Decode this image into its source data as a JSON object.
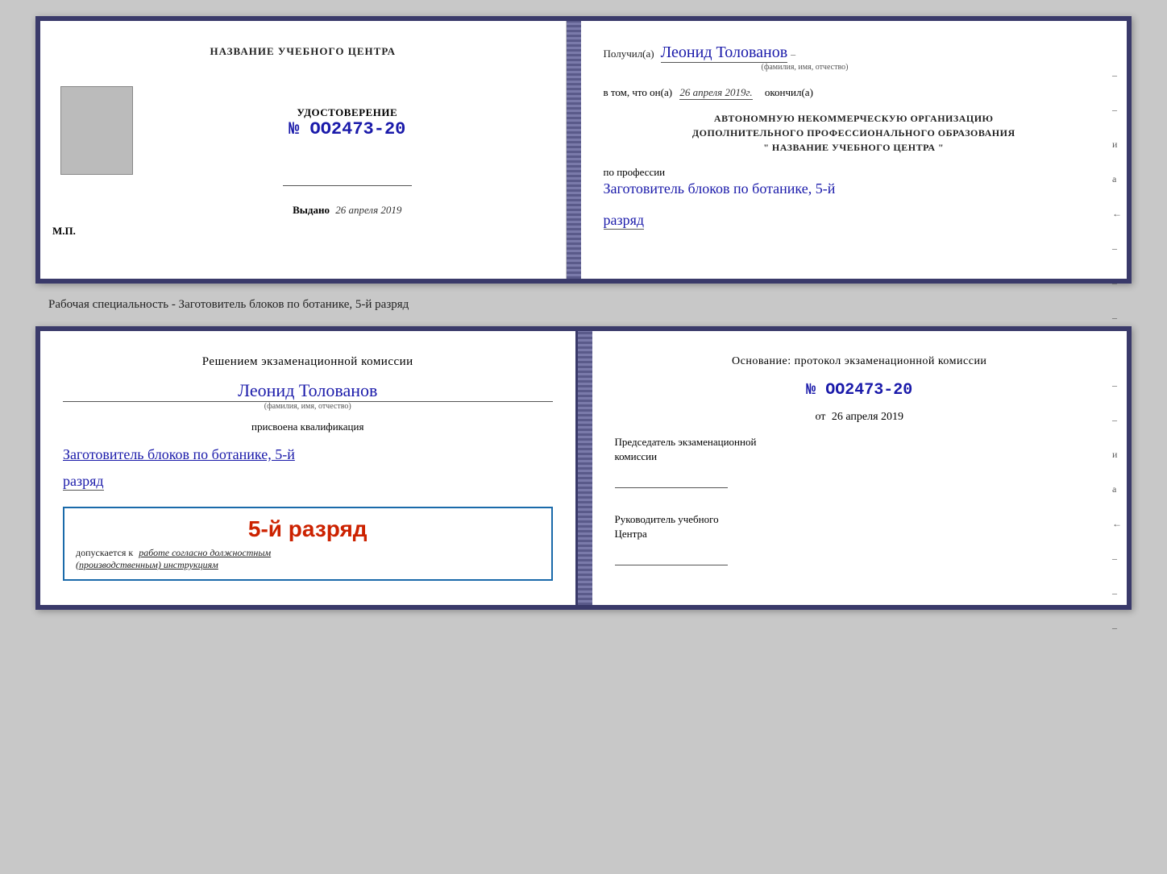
{
  "top_cert": {
    "left": {
      "title": "НАЗВАНИЕ УЧЕБНОГО ЦЕНТРА",
      "cert_label": "УДОСТОВЕРЕНИЕ",
      "cert_number": "№ OO2473-20",
      "issued_label": "Выдано",
      "issued_date": "26 апреля 2019",
      "mp_label": "М.П."
    },
    "right": {
      "received_label": "Получил(а)",
      "person_name": "Леонид Толованов",
      "name_subtitle": "(фамилия, имя, отчество)",
      "date_label": "в том, что он(а)",
      "date_value": "26 апреля 2019г.",
      "completed_label": "окончил(а)",
      "org_line1": "АВТОНОМНУЮ НЕКОММЕРЧЕСКУЮ ОРГАНИЗАЦИЮ",
      "org_line2": "ДОПОЛНИТЕЛЬНОГО ПРОФЕССИОНАЛЬНОГО ОБРАЗОВАНИЯ",
      "org_line3": "\"  НАЗВАНИЕ УЧЕБНОГО ЦЕНТРА  \"",
      "profession_label": "по профессии",
      "profession_name": "Заготовитель блоков по ботанике, 5-й",
      "razryad": "разряд",
      "side_marks": [
        "–",
        "–",
        "и",
        "а",
        "←",
        "–",
        "–",
        "–"
      ]
    }
  },
  "specialty_label": "Рабочая специальность - Заготовитель блоков по ботанике, 5-й разряд",
  "bottom_cert": {
    "left": {
      "commission_text": "Решением экзаменационной комиссии",
      "person_name": "Леонид Толованов",
      "name_subtitle": "(фамилия, имя, отчество)",
      "qualification_label": "присвоена квалификация",
      "qualification_name": "Заготовитель блоков по ботанике, 5-й",
      "razryad": "разряд",
      "stamp_grade": "5-й разряд",
      "stamp_allow_prefix": "допускается к",
      "stamp_allow_text": "работе согласно должностным",
      "stamp_allow_text2": "(производственным) инструкциям"
    },
    "right": {
      "basis_label": "Основание: протокол экзаменационной комиссии",
      "protocol_number": "№  OO2473-20",
      "date_prefix": "от",
      "date_value": "26 апреля 2019",
      "chairman_label": "Председатель экзаменационной",
      "chairman_label2": "комиссии",
      "director_label": "Руководитель учебного",
      "director_label2": "Центра",
      "side_marks": [
        "–",
        "–",
        "и",
        "а",
        "←",
        "–",
        "–",
        "–"
      ]
    }
  }
}
